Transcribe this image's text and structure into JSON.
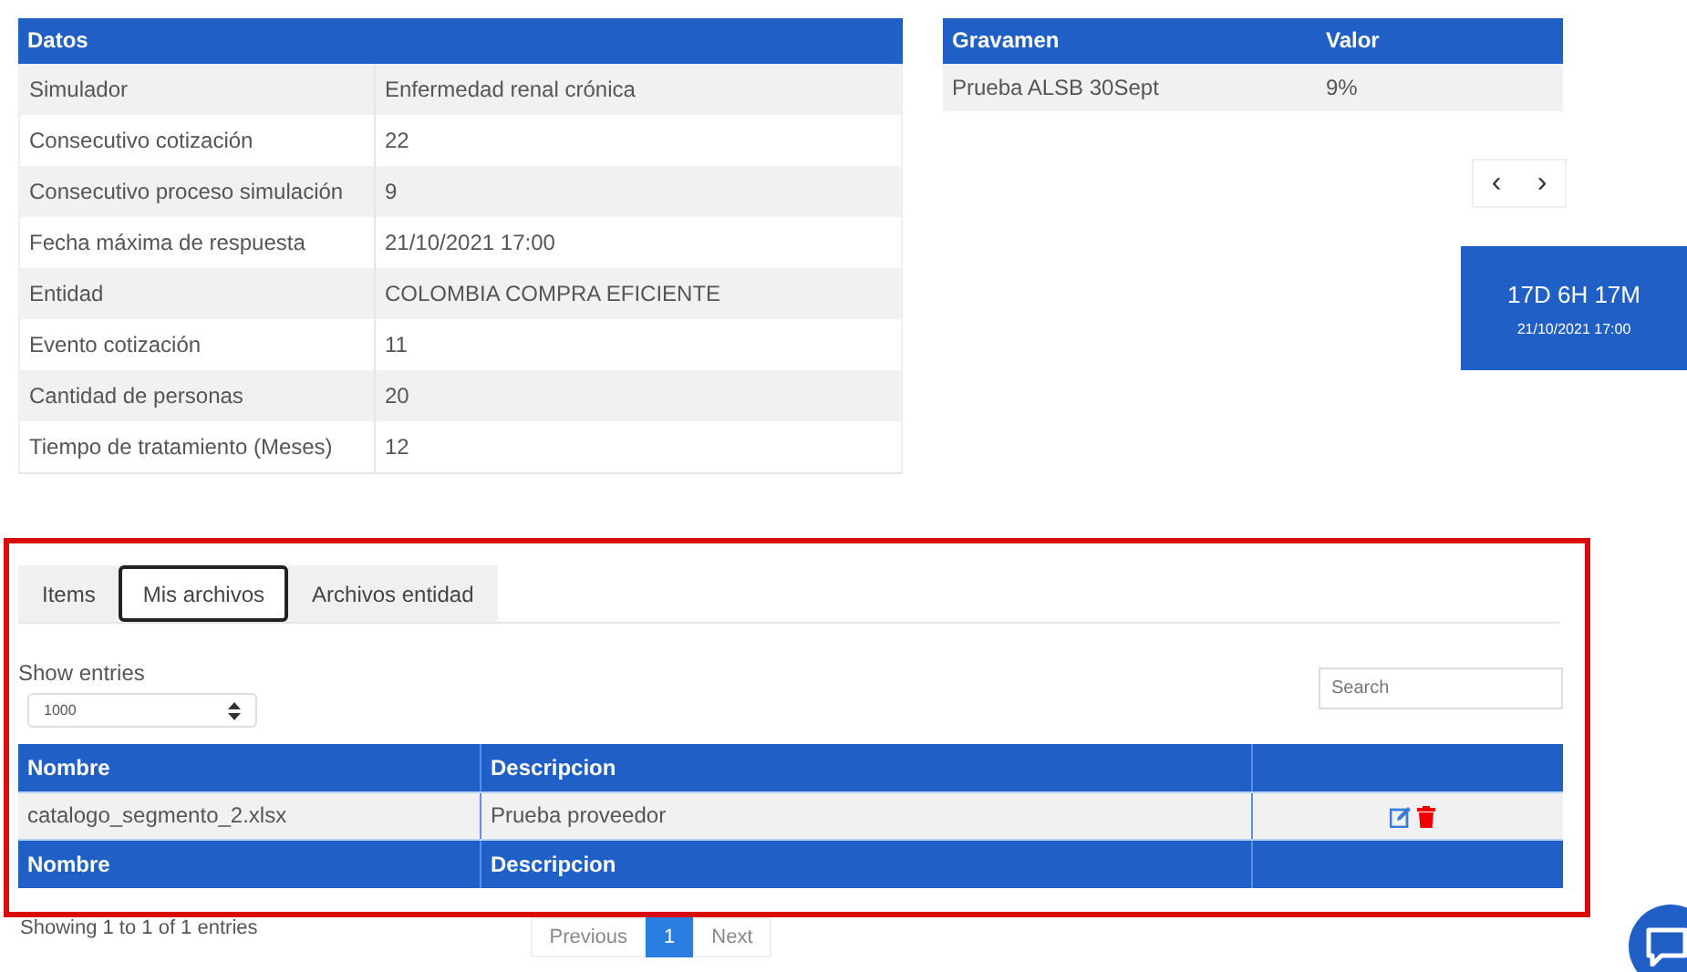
{
  "datos": {
    "title": "Datos",
    "rows": [
      {
        "label": "Simulador",
        "value": "Enfermedad renal crónica"
      },
      {
        "label": "Consecutivo cotización",
        "value": "22"
      },
      {
        "label": "Consecutivo proceso simulación",
        "value": "9"
      },
      {
        "label": "Fecha máxima de respuesta",
        "value": "21/10/2021 17:00"
      },
      {
        "label": "Entidad",
        "value": "COLOMBIA COMPRA EFICIENTE"
      },
      {
        "label": "Evento cotización",
        "value": "11"
      },
      {
        "label": "Cantidad de personas",
        "value": "20"
      },
      {
        "label": "Tiempo de tratamiento (Meses)",
        "value": "12"
      }
    ]
  },
  "gravamen": {
    "columns": [
      "Gravamen",
      "Valor"
    ],
    "rows": [
      [
        "Prueba ALSB 30Sept",
        "9%"
      ]
    ]
  },
  "nav_buttons": [
    "‹",
    "›"
  ],
  "countdown": {
    "remaining": "17D 6H 17M",
    "deadline": "21/10/2021 17:00"
  },
  "tabs": [
    {
      "label": "Items",
      "selected": false
    },
    {
      "label": "Mis archivos",
      "selected": true
    },
    {
      "label": "Archivos entidad",
      "selected": false
    }
  ],
  "show_entries": {
    "label": "Show entries",
    "value": "1000"
  },
  "search": {
    "placeholder": "Search"
  },
  "files_table": {
    "columns": [
      "Nombre",
      "Descripcion"
    ],
    "rows": [
      [
        "catalogo_segmento_2.xlsx",
        "Prueba proveedor"
      ]
    ],
    "footer": [
      "Nombre",
      "Descripcion"
    ]
  },
  "info": "Showing 1 to 1 of 1 entries",
  "pagination": [
    {
      "label": "Previous",
      "selected": false
    },
    {
      "label": "1",
      "selected": true
    },
    {
      "label": "Next",
      "selected": false
    }
  ]
}
